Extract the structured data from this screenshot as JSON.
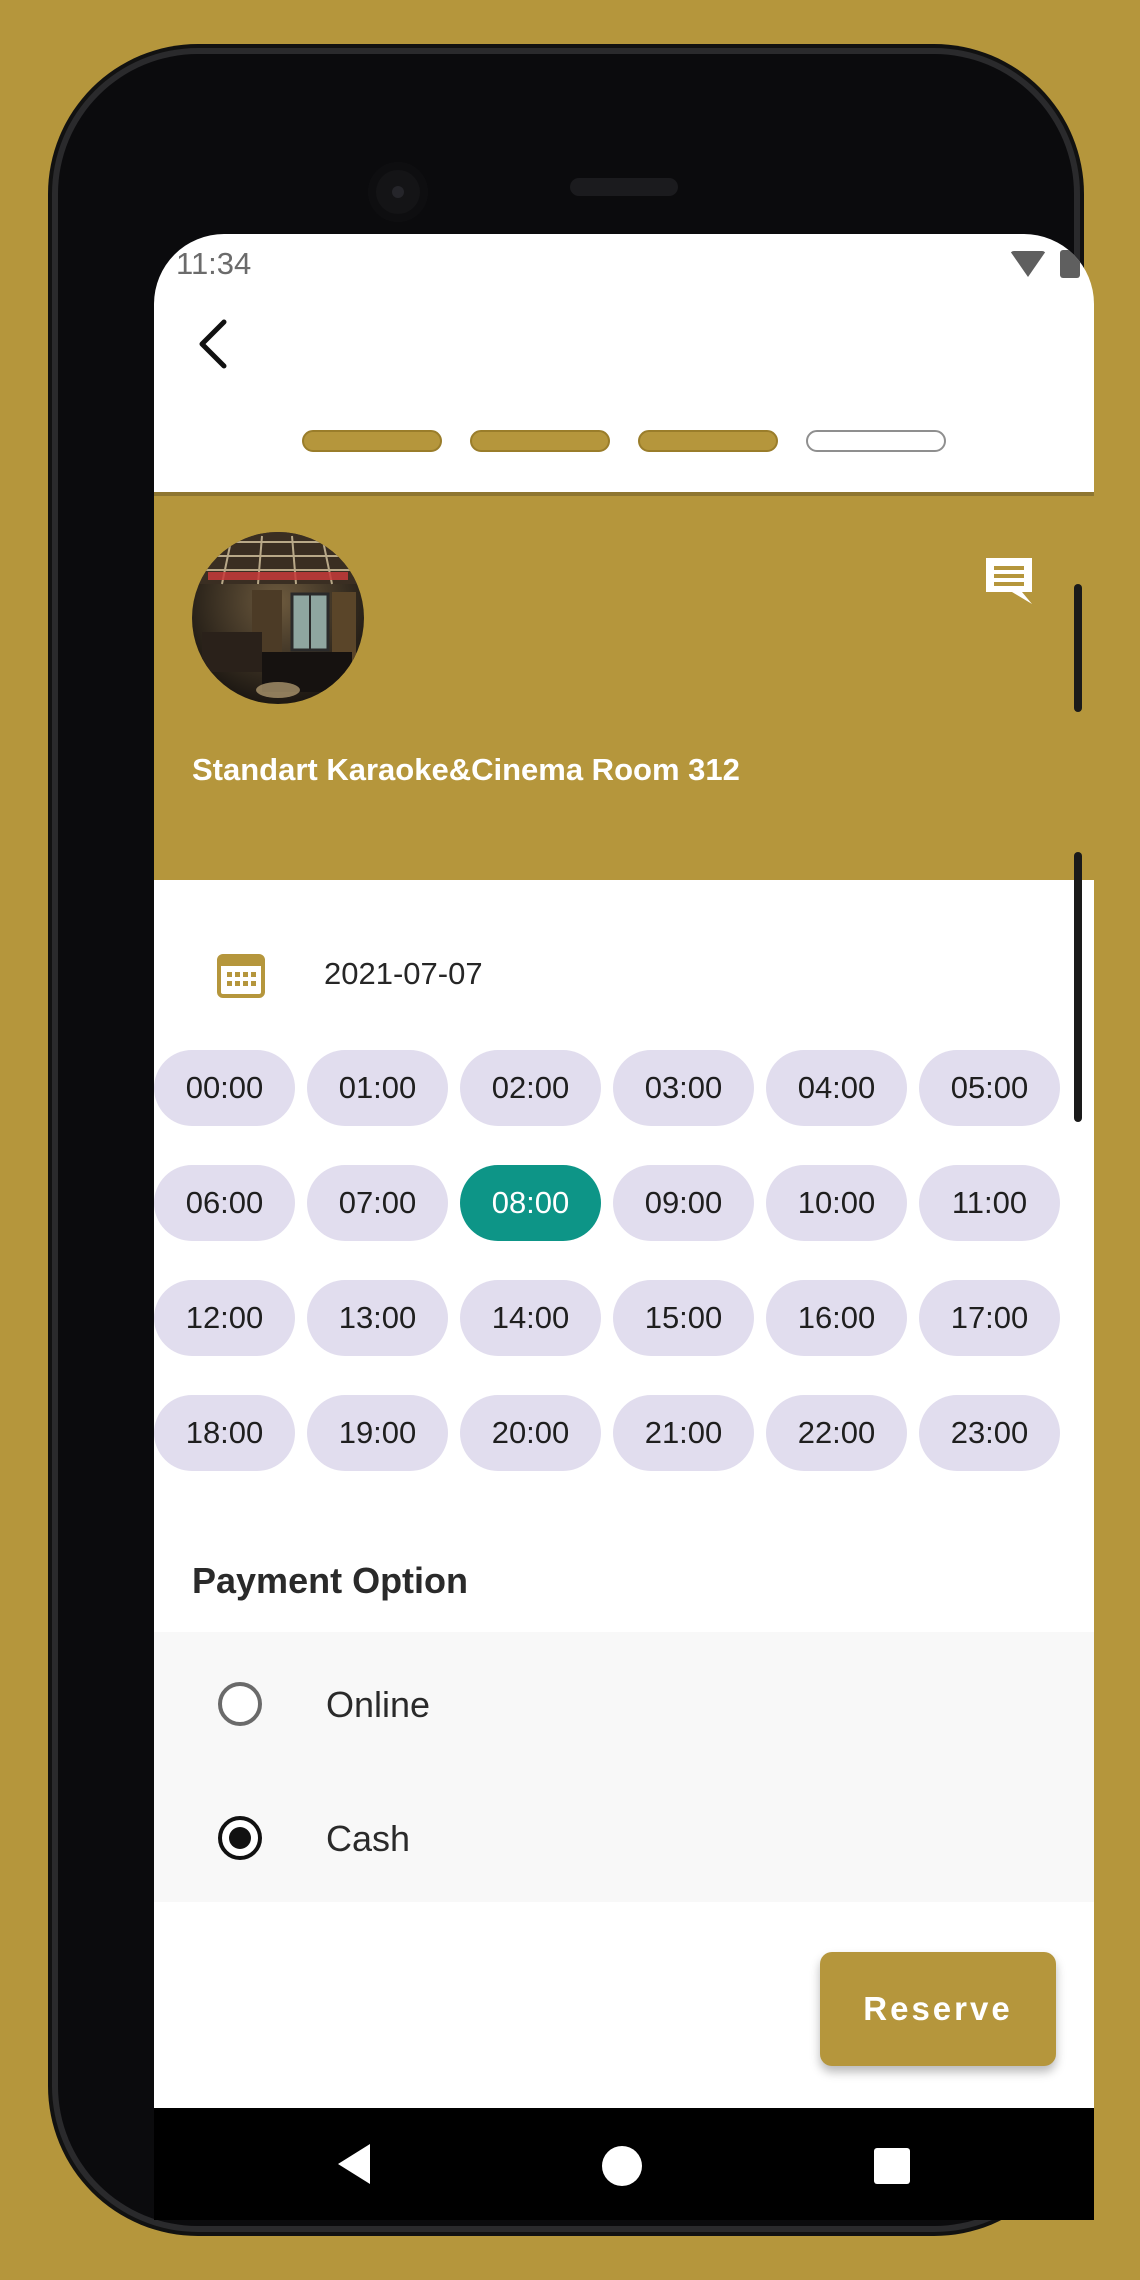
{
  "status_bar": {
    "time": "11:34",
    "wifi_icon": "wifi-icon",
    "battery_icon": "battery-icon"
  },
  "header": {
    "back_icon": "chevron-left-icon",
    "steps_total": 4,
    "steps_completed": 3
  },
  "room": {
    "title": "Standart Karaoke&Cinema Room 312",
    "chat_icon": "chat-icon"
  },
  "date": {
    "icon": "calendar-icon",
    "value": "2021-07-07"
  },
  "time_slots": [
    "00:00",
    "01:00",
    "02:00",
    "03:00",
    "04:00",
    "05:00",
    "06:00",
    "07:00",
    "08:00",
    "09:00",
    "10:00",
    "11:00",
    "12:00",
    "13:00",
    "14:00",
    "15:00",
    "16:00",
    "17:00",
    "18:00",
    "19:00",
    "20:00",
    "21:00",
    "22:00",
    "23:00"
  ],
  "selected_slot": "08:00",
  "payment": {
    "title": "Payment Option",
    "options": [
      {
        "label": "Online",
        "selected": false
      },
      {
        "label": "Cash",
        "selected": true
      }
    ]
  },
  "reserve_label": "Reserve",
  "colors": {
    "brand": "#b5963c",
    "selected_slot": "#0d9587",
    "slot": "#e1ddee"
  },
  "nav": {
    "back_icon": "nav-back-icon",
    "home_icon": "nav-home-icon",
    "recents_icon": "nav-recents-icon"
  }
}
